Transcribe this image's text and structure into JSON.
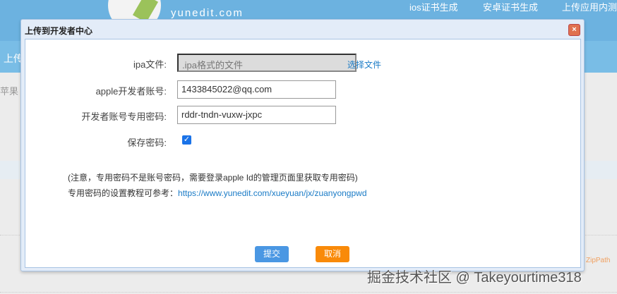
{
  "header": {
    "logo_text": "yunedit.com",
    "nav": [
      "ios证书生成",
      "安卓证书生成",
      "上传应用内测"
    ]
  },
  "background": {
    "band_text": "上传",
    "side_text": "苹果",
    "zip_text": "ZipPath"
  },
  "watermark": "掘金技术社区 @ Takeyourtime318",
  "dialog": {
    "title": "上传到开发者中心",
    "close_icon": "close-icon",
    "fields": {
      "ipa_label": "ipa文件:",
      "ipa_placeholder": ".ipa格式的文件",
      "choose_file": "选择文件",
      "account_label": "apple开发者账号:",
      "account_value": "1433845022@qq.com",
      "password_label": "开发者账号专用密码:",
      "password_value": "rddr-tndn-vuxw-jxpc",
      "save_label": "保存密码:",
      "save_checked": true
    },
    "note1": "(注意，专用密码不是账号密码，需要登录apple Id的管理页面里获取专用密码)",
    "note2_prefix": "专用密码的设置教程可参考：",
    "note2_link": "https://www.yunedit.com/xueyuan/jx/zuanyongpwd",
    "submit": "提交",
    "cancel": "取消",
    "colors": {
      "submit": "#4a97e3",
      "cancel": "#f98a09"
    }
  }
}
